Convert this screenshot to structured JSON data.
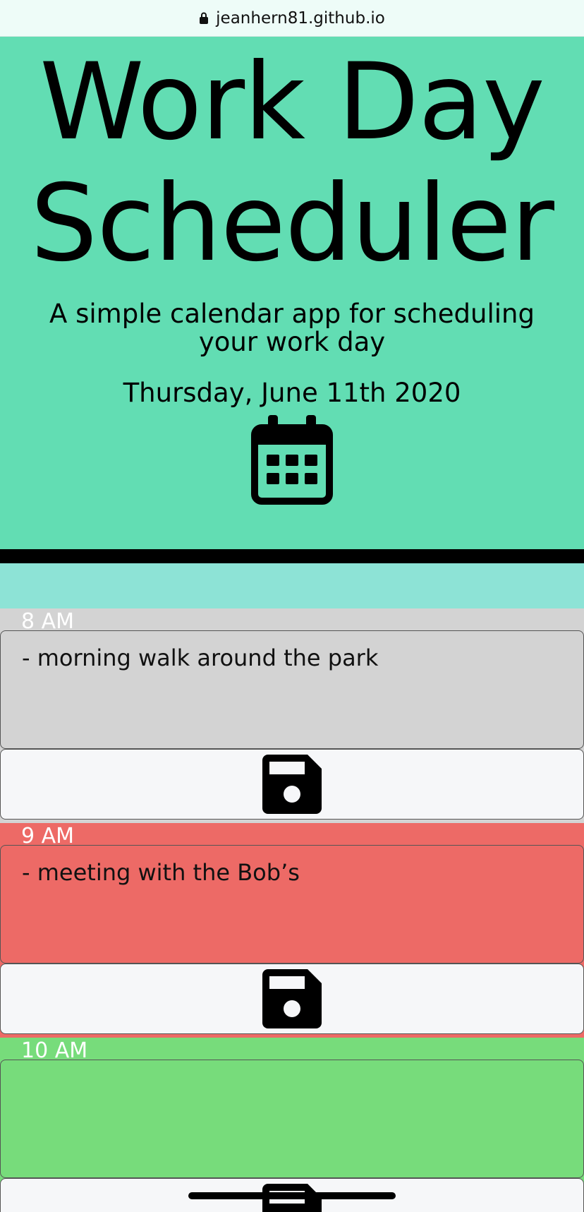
{
  "browser": {
    "url": "jeanhern81.github.io",
    "lock_icon": "lock-icon"
  },
  "header": {
    "title": "Work Day Scheduler",
    "lead": "A simple calendar app for scheduling your work day",
    "current_date": "Thursday, June 11th 2020",
    "icon": "calendar-icon"
  },
  "colors": {
    "jumbotron": "#62ddb3",
    "past": "#d3d3d3",
    "present": "#ed6a66",
    "future": "#77dc7b"
  },
  "time_blocks": [
    {
      "hour": "8 AM",
      "text": "- morning walk around the park",
      "state": "past",
      "save_icon": "save-icon"
    },
    {
      "hour": "9 AM",
      "text": "- meeting with the Bob’s",
      "state": "present",
      "save_icon": "save-icon"
    },
    {
      "hour": "10 AM",
      "text": "",
      "state": "future",
      "save_icon": "save-icon"
    }
  ]
}
